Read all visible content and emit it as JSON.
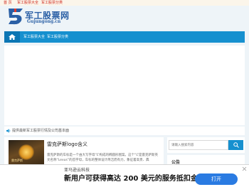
{
  "topbar": {
    "links": [
      "首 页",
      "军工股票大全",
      "军工股票分类"
    ]
  },
  "logo": {
    "title": "军工股票网",
    "url": "Gujungong.cn"
  },
  "nav": {
    "items": [
      "军工股票大全",
      "军工股票分类"
    ]
  },
  "notice": {
    "text": "提供最新军工股票行情及公司基本面"
  },
  "article": {
    "title": "雷克萨斯logo含义",
    "excerpt": "雷克萨斯的车标是一个由大写字母“L”构成的椭圆形图案。这个“L”是雷克萨斯英文名称“Lexus”的首字母，车标的整体设计简洁而有力，象征着高贵、典",
    "thumb_text": "雷克萨斯"
  },
  "search": {
    "placeholder": "请输入搜索内容"
  },
  "sidebar": {
    "notice_heading": "公告"
  },
  "ad": {
    "brand": "亚马逊云科技",
    "headline": "新用户可获得高达 200 美元的服务抵扣金",
    "button": "打开"
  },
  "colors": {
    "brand_blue": "#1690cf",
    "link_red": "#d0281c",
    "ad_button": "#2a7be2"
  }
}
